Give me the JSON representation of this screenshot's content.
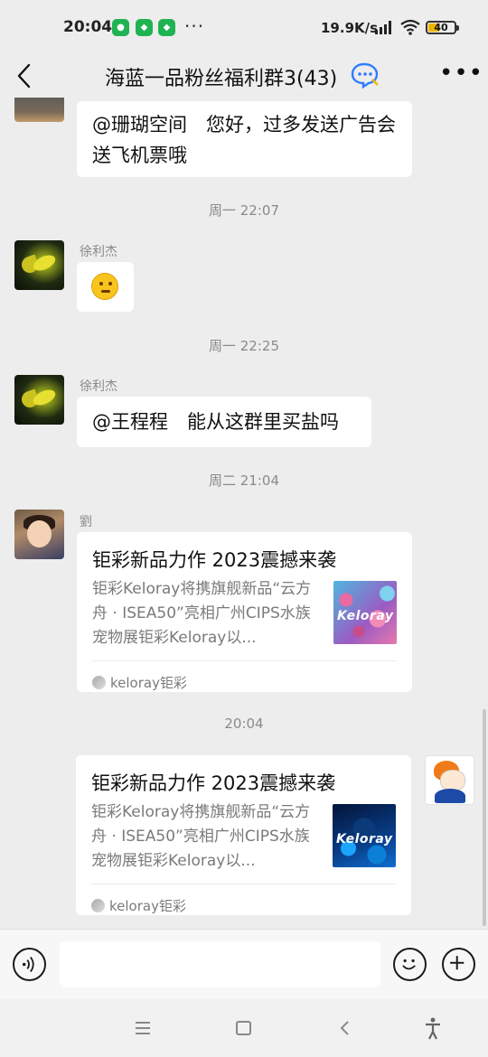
{
  "status_bar": {
    "time": "20:04",
    "network_speed": "19.9K/s",
    "battery_level": "40",
    "more_dots": "···"
  },
  "header": {
    "title": "海蓝一品粉丝福利群3(43)"
  },
  "messages": [
    {
      "type": "text",
      "sender": "",
      "text": "@珊瑚空间　您好，过多发送广告会送飞机票哦"
    },
    {
      "type": "time",
      "text": "周一 22:07"
    },
    {
      "type": "sticker",
      "sender": "徐利杰",
      "sticker_name": "thinking-face-icon"
    },
    {
      "type": "time",
      "text": "周一 22:25"
    },
    {
      "type": "text",
      "sender": "徐利杰",
      "text": "@王程程　能从这群里买盐吗"
    },
    {
      "type": "time",
      "text": "周二 21:04"
    },
    {
      "type": "link_card",
      "sender": "劉",
      "title": "钜彩新品力作 2023震撼来袭",
      "description": "钜彩Keloray将携旗舰新品“云方舟 · ISEA50”亮相广州CIPS水族宠物展钜彩Keloray以...",
      "thumb_text": "Keloray",
      "source": "keloray钜彩"
    },
    {
      "type": "time",
      "text": "20:04"
    },
    {
      "type": "link_card",
      "sender": "me",
      "title": "钜彩新品力作 2023震撼来袭",
      "description": "钜彩Keloray将携旗舰新品“云方舟 · ISEA50”亮相广州CIPS水族宠物展钜彩Keloray以...",
      "thumb_text": "Keloray",
      "source": "keloray钜彩"
    }
  ],
  "input_bar": {
    "placeholder": ""
  },
  "colors": {
    "background": "#ededed",
    "bubble": "#ffffff",
    "meta_text": "#8a8a8a",
    "bot_icon": "#2f7bff"
  }
}
